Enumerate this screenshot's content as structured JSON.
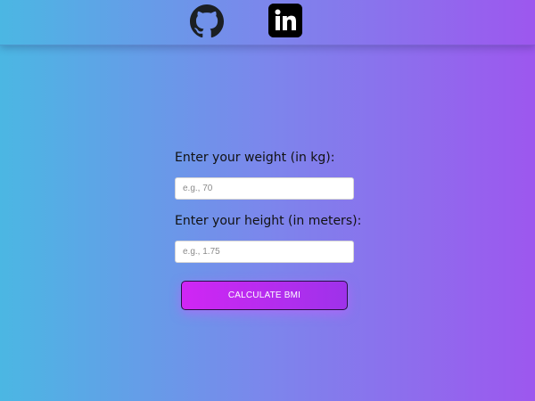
{
  "header": {
    "icons": [
      "github-icon",
      "linkedin-icon"
    ]
  },
  "form": {
    "weight_label": "Enter your weight (in kg):",
    "weight_placeholder": "e.g., 70",
    "weight_value": "",
    "height_label": "Enter your height (in meters):",
    "height_placeholder": "e.g., 1.75",
    "height_value": "",
    "button_label": "CALCULATE BMI"
  },
  "colors": {
    "gradient_start": "#4bb7e3",
    "gradient_end": "#9d57ee",
    "button_start": "#d026f4",
    "button_end": "#9e32ea"
  }
}
